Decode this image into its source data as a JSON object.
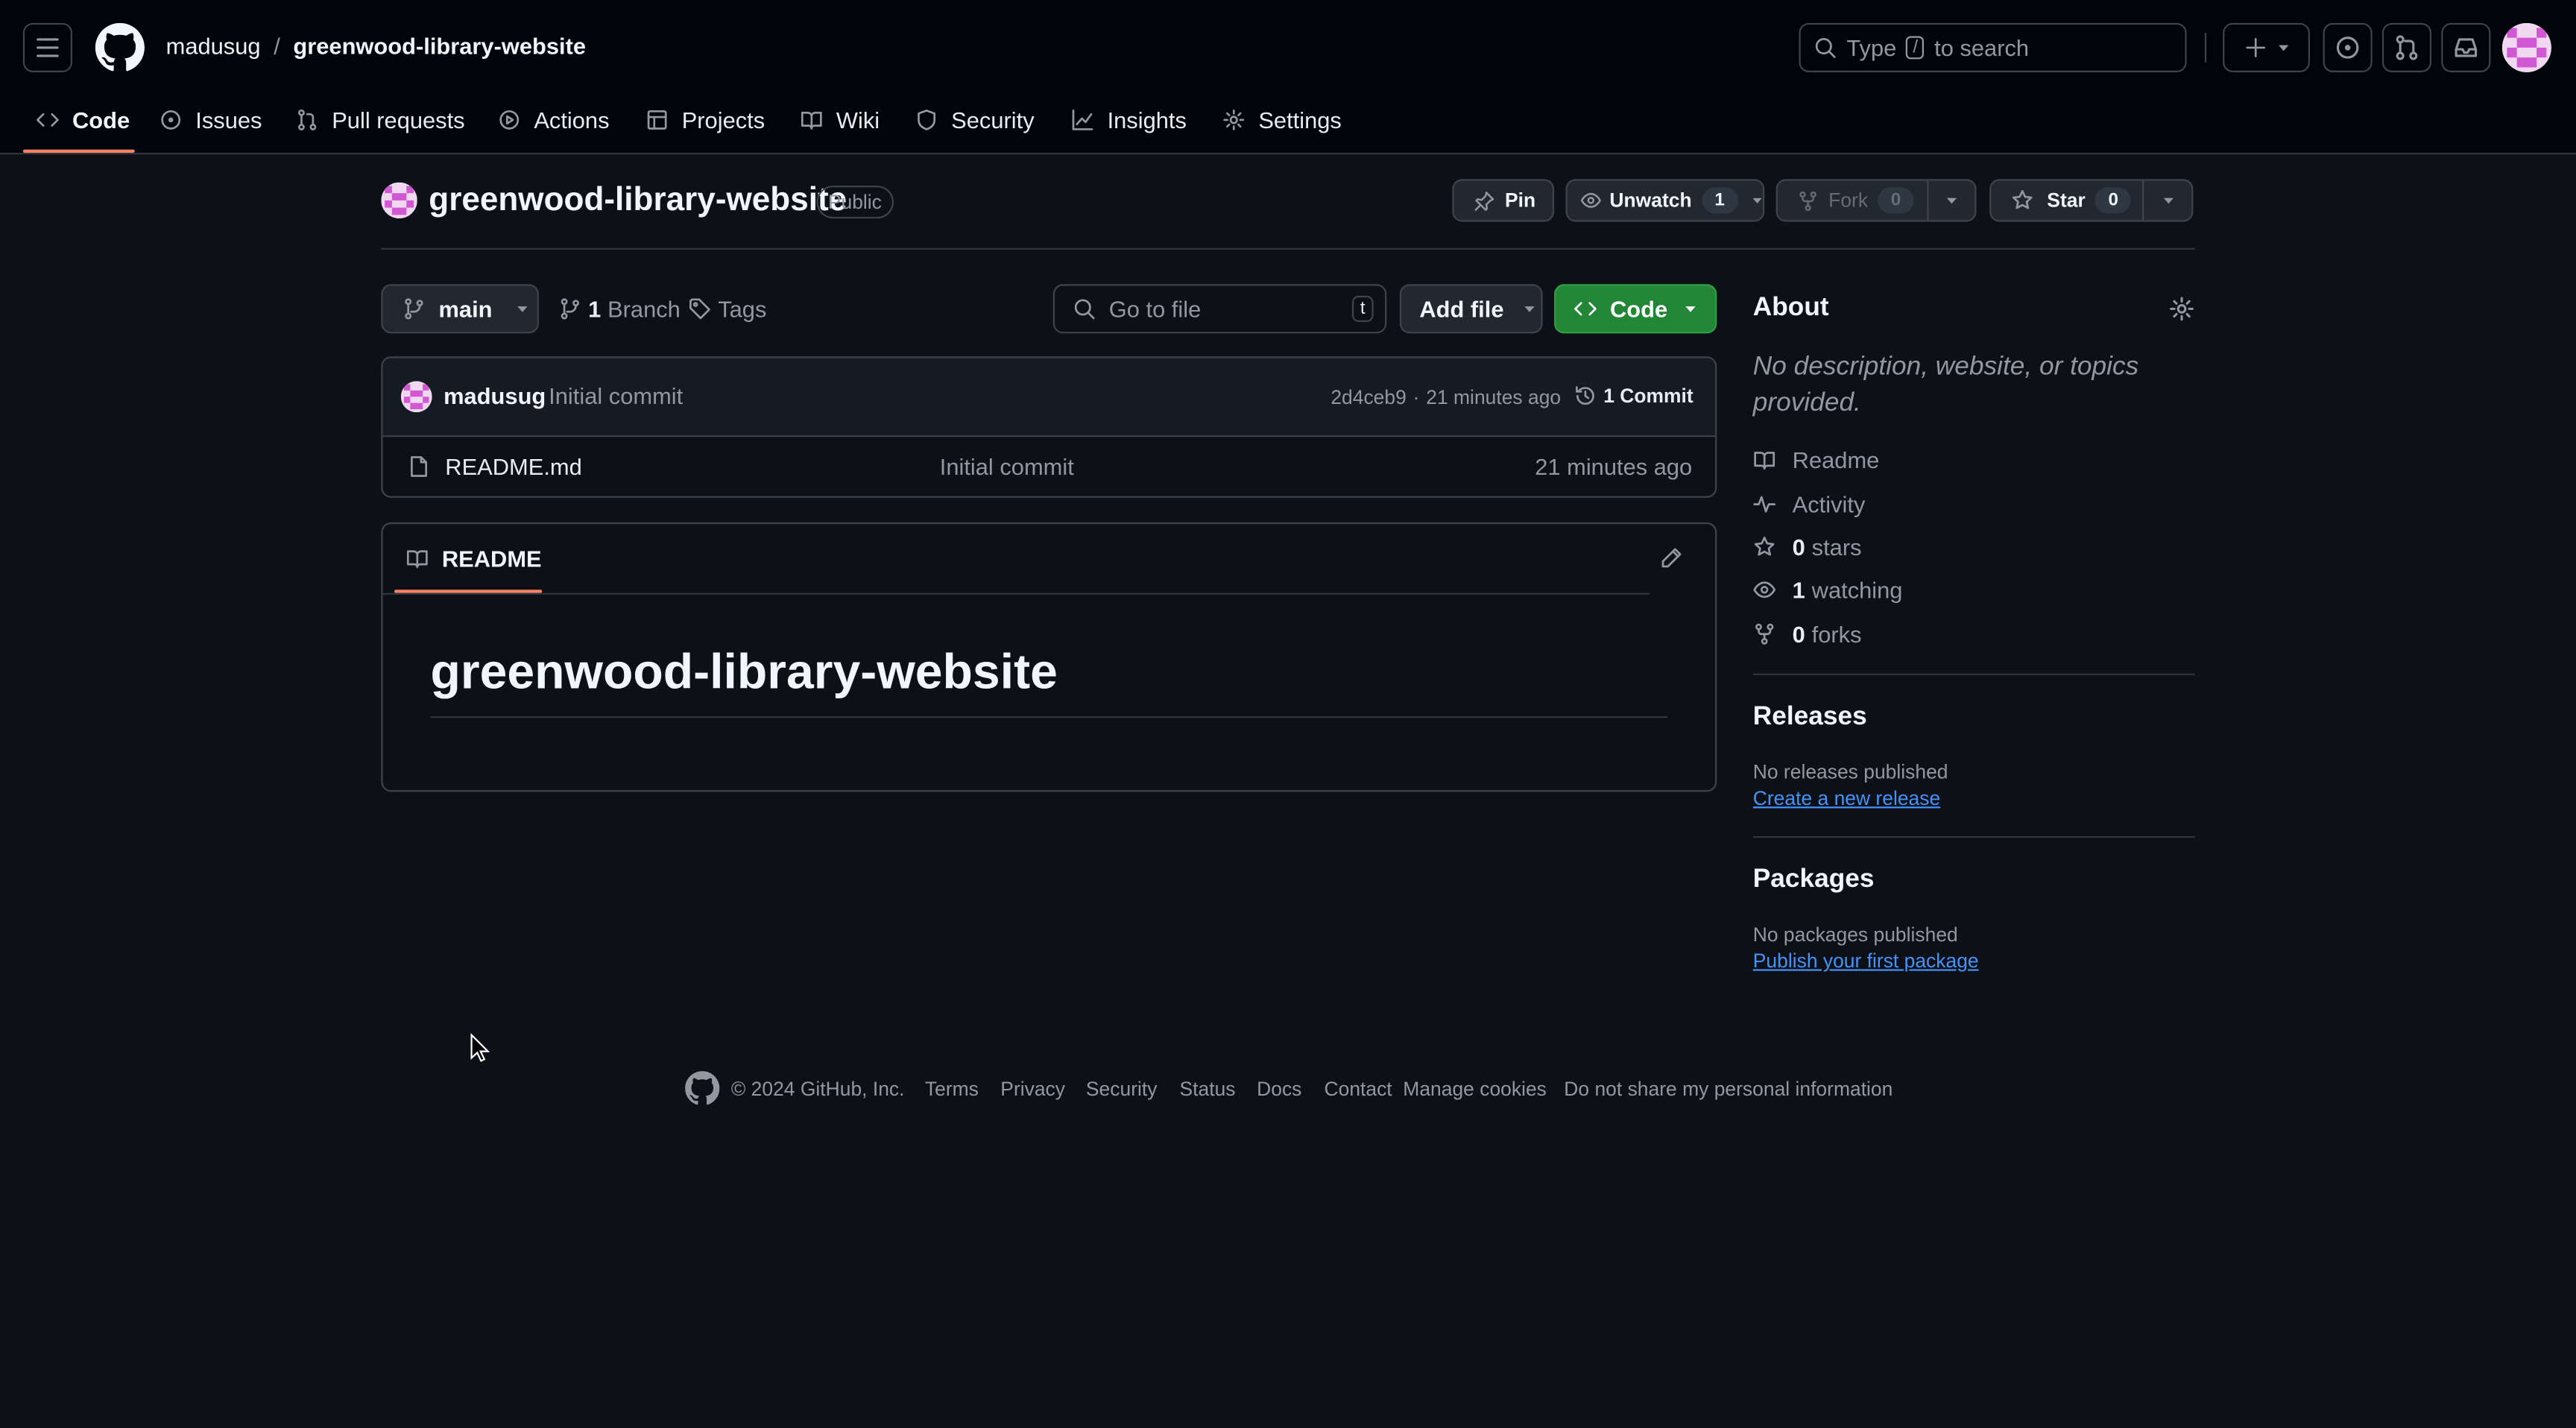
{
  "header": {
    "owner": "madusug",
    "separator": "/",
    "repo": "greenwood-library-website",
    "search_prefix": "Type",
    "search_key": "/",
    "search_suffix": "to search"
  },
  "tabs": [
    {
      "label": "Code",
      "icon": "code-icon"
    },
    {
      "label": "Issues",
      "icon": "issue-icon"
    },
    {
      "label": "Pull requests",
      "icon": "pull-request-icon"
    },
    {
      "label": "Actions",
      "icon": "play-icon"
    },
    {
      "label": "Projects",
      "icon": "table-icon"
    },
    {
      "label": "Wiki",
      "icon": "book-icon"
    },
    {
      "label": "Security",
      "icon": "shield-icon"
    },
    {
      "label": "Insights",
      "icon": "graph-icon"
    },
    {
      "label": "Settings",
      "icon": "gear-icon"
    }
  ],
  "repo_head": {
    "name": "greenwood-library-website",
    "visibility": "Public",
    "pin": "Pin",
    "unwatch": "Unwatch",
    "watch_count": "1",
    "fork": "Fork",
    "fork_count": "0",
    "star": "Star",
    "star_count": "0"
  },
  "toolbar": {
    "branch": "main",
    "branch_count": "1",
    "branch_label": "Branch",
    "tags": "Tags",
    "goto_placeholder": "Go to file",
    "goto_key": "t",
    "add_file": "Add file",
    "code": "Code"
  },
  "commit": {
    "author": "madusug",
    "message": "Initial commit",
    "hash": "2d4ceb9",
    "dot": "·",
    "time": "21 minutes ago",
    "count": "1 Commit"
  },
  "files": [
    {
      "name": "README.md",
      "message": "Initial commit",
      "time": "21 minutes ago"
    }
  ],
  "readme": {
    "tab": "README",
    "heading": "greenwood-library-website"
  },
  "about": {
    "title": "About",
    "description": "No description, website, or topics provided.",
    "readme": "Readme",
    "activity": "Activity",
    "stars_n": "0",
    "stars": "stars",
    "watching_n": "1",
    "watching": "watching",
    "forks_n": "0",
    "forks": "forks"
  },
  "releases": {
    "title": "Releases",
    "empty": "No releases published",
    "create": "Create a new release"
  },
  "packages": {
    "title": "Packages",
    "empty": "No packages published",
    "publish": "Publish your first package"
  },
  "footer": {
    "copyright": "© 2024 GitHub, Inc.",
    "links": [
      "Terms",
      "Privacy",
      "Security",
      "Status",
      "Docs",
      "Contact",
      "Manage cookies",
      "Do not share my personal information"
    ]
  },
  "colors": {
    "bg": "#0d1117",
    "header_bg": "#010409",
    "accent_green": "#238636",
    "link_blue": "#4493f8",
    "tab_underline": "#f78166",
    "avatar_pink": "#d257d2"
  }
}
